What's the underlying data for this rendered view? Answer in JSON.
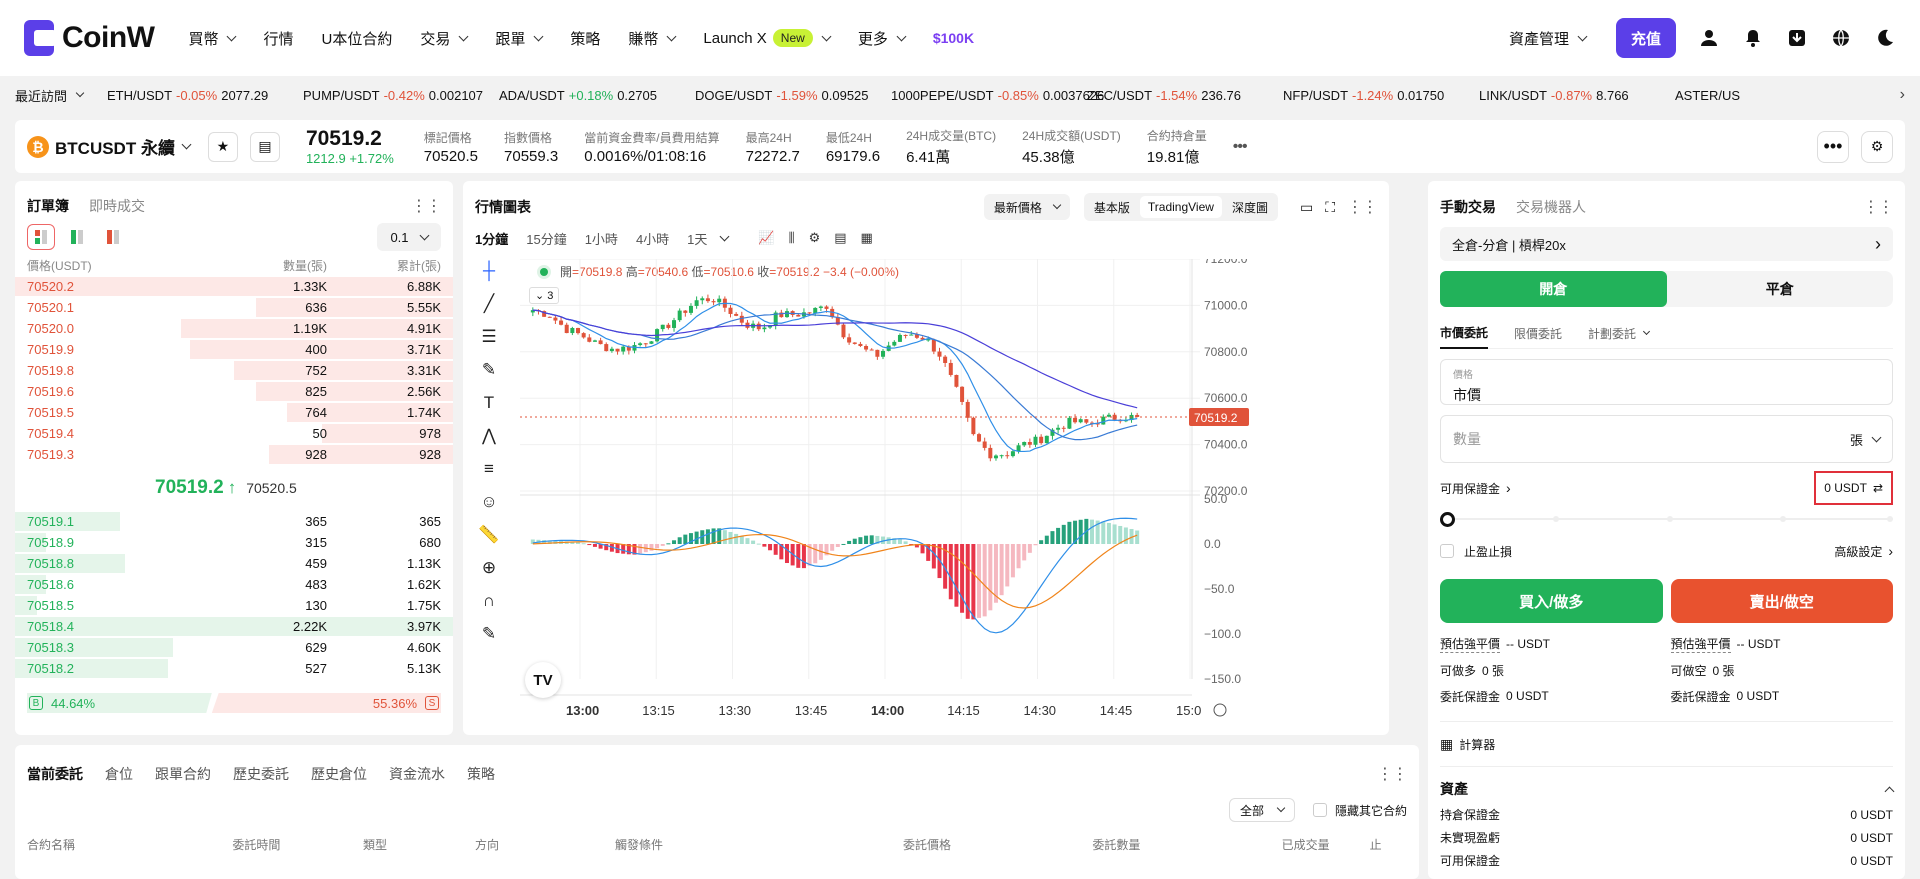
{
  "brand": {
    "name": "CoinW"
  },
  "nav": [
    {
      "label": "買幣",
      "dropdown": true
    },
    {
      "label": "行情",
      "dropdown": false
    },
    {
      "label": "U本位合約",
      "dropdown": false
    },
    {
      "label": "交易",
      "dropdown": true
    },
    {
      "label": "跟單",
      "dropdown": true
    },
    {
      "label": "策略",
      "dropdown": false
    },
    {
      "label": "賺幣",
      "dropdown": true
    },
    {
      "label": "Launch X",
      "dropdown": true,
      "badge": "New"
    },
    {
      "label": "更多",
      "dropdown": true
    }
  ],
  "nav_promo": "$100K",
  "nav_right": {
    "asset_mgmt": "資產管理",
    "deposit": "充值"
  },
  "ticker": {
    "label": "最近訪問",
    "items": [
      {
        "pair": "ETH/USDT",
        "change": "-0.05%",
        "price": "2077.29"
      },
      {
        "pair": "PUMP/USDT",
        "change": "-0.42%",
        "price": "0.002107"
      },
      {
        "pair": "ADA/USDT",
        "change": "+0.18%",
        "price": "0.2705"
      },
      {
        "pair": "DOGE/USDT",
        "change": "-1.59%",
        "price": "0.09525"
      },
      {
        "pair": "1000PEPE/USDT",
        "change": "-0.85%",
        "price": "0.0037626"
      },
      {
        "pair": "ZEC/USDT",
        "change": "-1.54%",
        "price": "236.76"
      },
      {
        "pair": "NFP/USDT",
        "change": "-1.24%",
        "price": "0.01750"
      },
      {
        "pair": "LINK/USDT",
        "change": "-0.87%",
        "price": "8.766"
      },
      {
        "pair": "ASTER/US",
        "change": "",
        "price": ""
      }
    ]
  },
  "instrument": {
    "symbol": "BTCUSDT 永續",
    "last": "70519.2",
    "change_abs": "1212.9",
    "change_pct": "+1.72%",
    "stats": [
      {
        "label": "標記價格",
        "value": "70520.5"
      },
      {
        "label": "指數價格",
        "value": "70559.3"
      },
      {
        "label": "當前資金費率/員費用結算",
        "value": "0.0016%/01:08:16"
      },
      {
        "label": "最高24H",
        "value": "72272.7"
      },
      {
        "label": "最低24H",
        "value": "69179.6"
      },
      {
        "label": "24H成交量(BTC)",
        "value": "6.41萬"
      },
      {
        "label": "24H成交額(USDT)",
        "value": "45.38億"
      },
      {
        "label": "合約持倉量",
        "value": "19.81億"
      }
    ]
  },
  "orderbook": {
    "tab_active": "訂單簿",
    "tab_other": "即時成交",
    "precision": "0.1",
    "headers": {
      "price": "價格(USDT)",
      "qty": "數量(張)",
      "total": "累計(張)"
    },
    "asks": [
      {
        "price": "70520.2",
        "qty": "1.33K",
        "total": "6.88K",
        "depth": 1.0
      },
      {
        "price": "70520.1",
        "qty": "636",
        "total": "5.55K",
        "depth": 0.45
      },
      {
        "price": "70520.0",
        "qty": "1.19K",
        "total": "4.91K",
        "depth": 0.62
      },
      {
        "price": "70519.9",
        "qty": "400",
        "total": "3.71K",
        "depth": 0.6
      },
      {
        "price": "70519.8",
        "qty": "752",
        "total": "3.31K",
        "depth": 0.5
      },
      {
        "price": "70519.6",
        "qty": "825",
        "total": "2.56K",
        "depth": 0.45
      },
      {
        "price": "70519.5",
        "qty": "764",
        "total": "1.74K",
        "depth": 0.38
      },
      {
        "price": "70519.4",
        "qty": "50",
        "total": "978",
        "depth": 0.3
      },
      {
        "price": "70519.3",
        "qty": "928",
        "total": "928",
        "depth": 0.42
      }
    ],
    "mid": {
      "price": "70519.2",
      "arrow": "↑",
      "mark": "70520.5"
    },
    "bids": [
      {
        "price": "70519.1",
        "qty": "365",
        "total": "365",
        "depth": 0.24
      },
      {
        "price": "70518.9",
        "qty": "315",
        "total": "680",
        "depth": 0.07
      },
      {
        "price": "70518.8",
        "qty": "459",
        "total": "1.13K",
        "depth": 0.25
      },
      {
        "price": "70518.6",
        "qty": "483",
        "total": "1.62K",
        "depth": 0.07
      },
      {
        "price": "70518.5",
        "qty": "130",
        "total": "1.75K",
        "depth": 0.05
      },
      {
        "price": "70518.4",
        "qty": "2.22K",
        "total": "3.97K",
        "depth": 1.0
      },
      {
        "price": "70518.3",
        "qty": "629",
        "total": "4.60K",
        "depth": 0.36
      },
      {
        "price": "70518.2",
        "qty": "527",
        "total": "5.13K",
        "depth": 0.35
      }
    ],
    "ratio": {
      "buy_label": "B",
      "buy": "44.64%",
      "sell": "55.36%",
      "sell_label": "S",
      "buy_frac": 0.4464
    }
  },
  "chart": {
    "title": "行情圖表",
    "price_type": "最新價格",
    "views": [
      "基本版",
      "TradingView",
      "深度圖"
    ],
    "active_view": "TradingView",
    "intervals": [
      "1分鐘",
      "15分鐘",
      "1小時",
      "4小時",
      "1天"
    ],
    "active_interval": "1分鐘",
    "ohlc": {
      "open_label": "開",
      "open": "=70519.8",
      "high_label": "高",
      "high": "=70540.6",
      "low_label": "低",
      "low": "=70510.6",
      "close_label": "收",
      "close": "=70519.2",
      "change": "−3.4 (−0.00%)"
    },
    "indicator_count": "3",
    "current_price_tag": "70519.2",
    "time_labels": [
      "13:00",
      "13:15",
      "13:30",
      "13:45",
      "14:00",
      "14:15",
      "14:30",
      "14:45",
      "15:0"
    ]
  },
  "chart_data": {
    "type": "candlestick",
    "price_ticks": [
      "71200.0",
      "71000.0",
      "70800.0",
      "70600.0",
      "70400.0",
      "70200.0"
    ],
    "macd_ticks": [
      "50.0",
      "0.0",
      "−50.0",
      "−100.0",
      "−150.0"
    ],
    "price_ylim": [
      70200,
      71200
    ],
    "macd_ylim": [
      -150,
      50
    ],
    "time_axis": [
      "13:00",
      "13:15",
      "13:30",
      "13:45",
      "14:00",
      "14:15",
      "14:30",
      "14:45",
      "15:0"
    ],
    "series": [
      {
        "values_key": "candles",
        "close_anchors": [
          70980,
          70960,
          70900,
          70870,
          70830,
          70810,
          70820,
          70850,
          70900,
          70960,
          71020,
          71030,
          70980,
          70920,
          70900,
          70960,
          70960,
          70970,
          71000,
          70880,
          70820,
          70780,
          70840,
          70880,
          70860,
          70780,
          70620,
          70430,
          70360,
          70360,
          70400,
          70420,
          70470,
          70500,
          70490,
          70510,
          70520,
          70519.2
        ]
      },
      {
        "values_key": "macd_hist",
        "anchors": [
          5,
          4,
          3,
          1,
          -5,
          -10,
          -12,
          -8,
          0,
          10,
          15,
          18,
          12,
          5,
          -5,
          -20,
          -28,
          -20,
          -5,
          5,
          10,
          8,
          5,
          -5,
          -30,
          -65,
          -85,
          -80,
          -55,
          -25,
          0,
          15,
          25,
          28,
          25,
          20,
          15
        ]
      }
    ]
  },
  "order_form": {
    "tab_active": "手動交易",
    "tab_other": "交易機器人",
    "margin_mode": "全倉-分倉 | 槓桿20x",
    "open": "開倉",
    "close": "平倉",
    "order_types": [
      "市價委託",
      "限價委託",
      "計劃委託"
    ],
    "active_order_type": "市價委託",
    "price_label": "價格",
    "price_value": "市價",
    "qty_placeholder": "數量",
    "qty_unit": "張",
    "avail_label": "可用保證金",
    "avail_value": "0 USDT",
    "tpsl": "止盈止損",
    "advanced": "高級設定",
    "buy": "買入/做多",
    "sell": "賣出/做空",
    "buy_info": [
      {
        "label": "預估強平價",
        "value": "-- USDT"
      },
      {
        "label": "可做多",
        "value": "0 張"
      },
      {
        "label": "委託保證金",
        "value": "0 USDT"
      }
    ],
    "sell_info": [
      {
        "label": "預估強平價",
        "value": "-- USDT"
      },
      {
        "label": "可做空",
        "value": "0 張"
      },
      {
        "label": "委託保證金",
        "value": "0 USDT"
      }
    ],
    "calculator": "計算器",
    "assets_title": "資產",
    "assets": [
      {
        "label": "持倉保證金",
        "value": "0 USDT"
      },
      {
        "label": "未實現盈虧",
        "value": "0 USDT"
      },
      {
        "label": "可用保證金",
        "value": "0 USDT"
      }
    ]
  },
  "bottom": {
    "tabs": [
      "當前委託",
      "倉位",
      "跟單合約",
      "歷史委託",
      "歷史倉位",
      "資金流水",
      "策略"
    ],
    "active_tab": "當前委託",
    "filter": "全部",
    "hide_other": "隱藏其它合約",
    "columns": [
      "合約名稱",
      "委託時間",
      "類型",
      "方向",
      "觸發條件",
      "委託價格",
      "委託數量",
      "已成交量",
      "止"
    ]
  },
  "colors": {
    "accent": "#5b3fe8",
    "up": "#22b25a",
    "down": "#e0533a",
    "ask_bg": "#fde8e6",
    "bid_bg": "#e5f5ea"
  }
}
